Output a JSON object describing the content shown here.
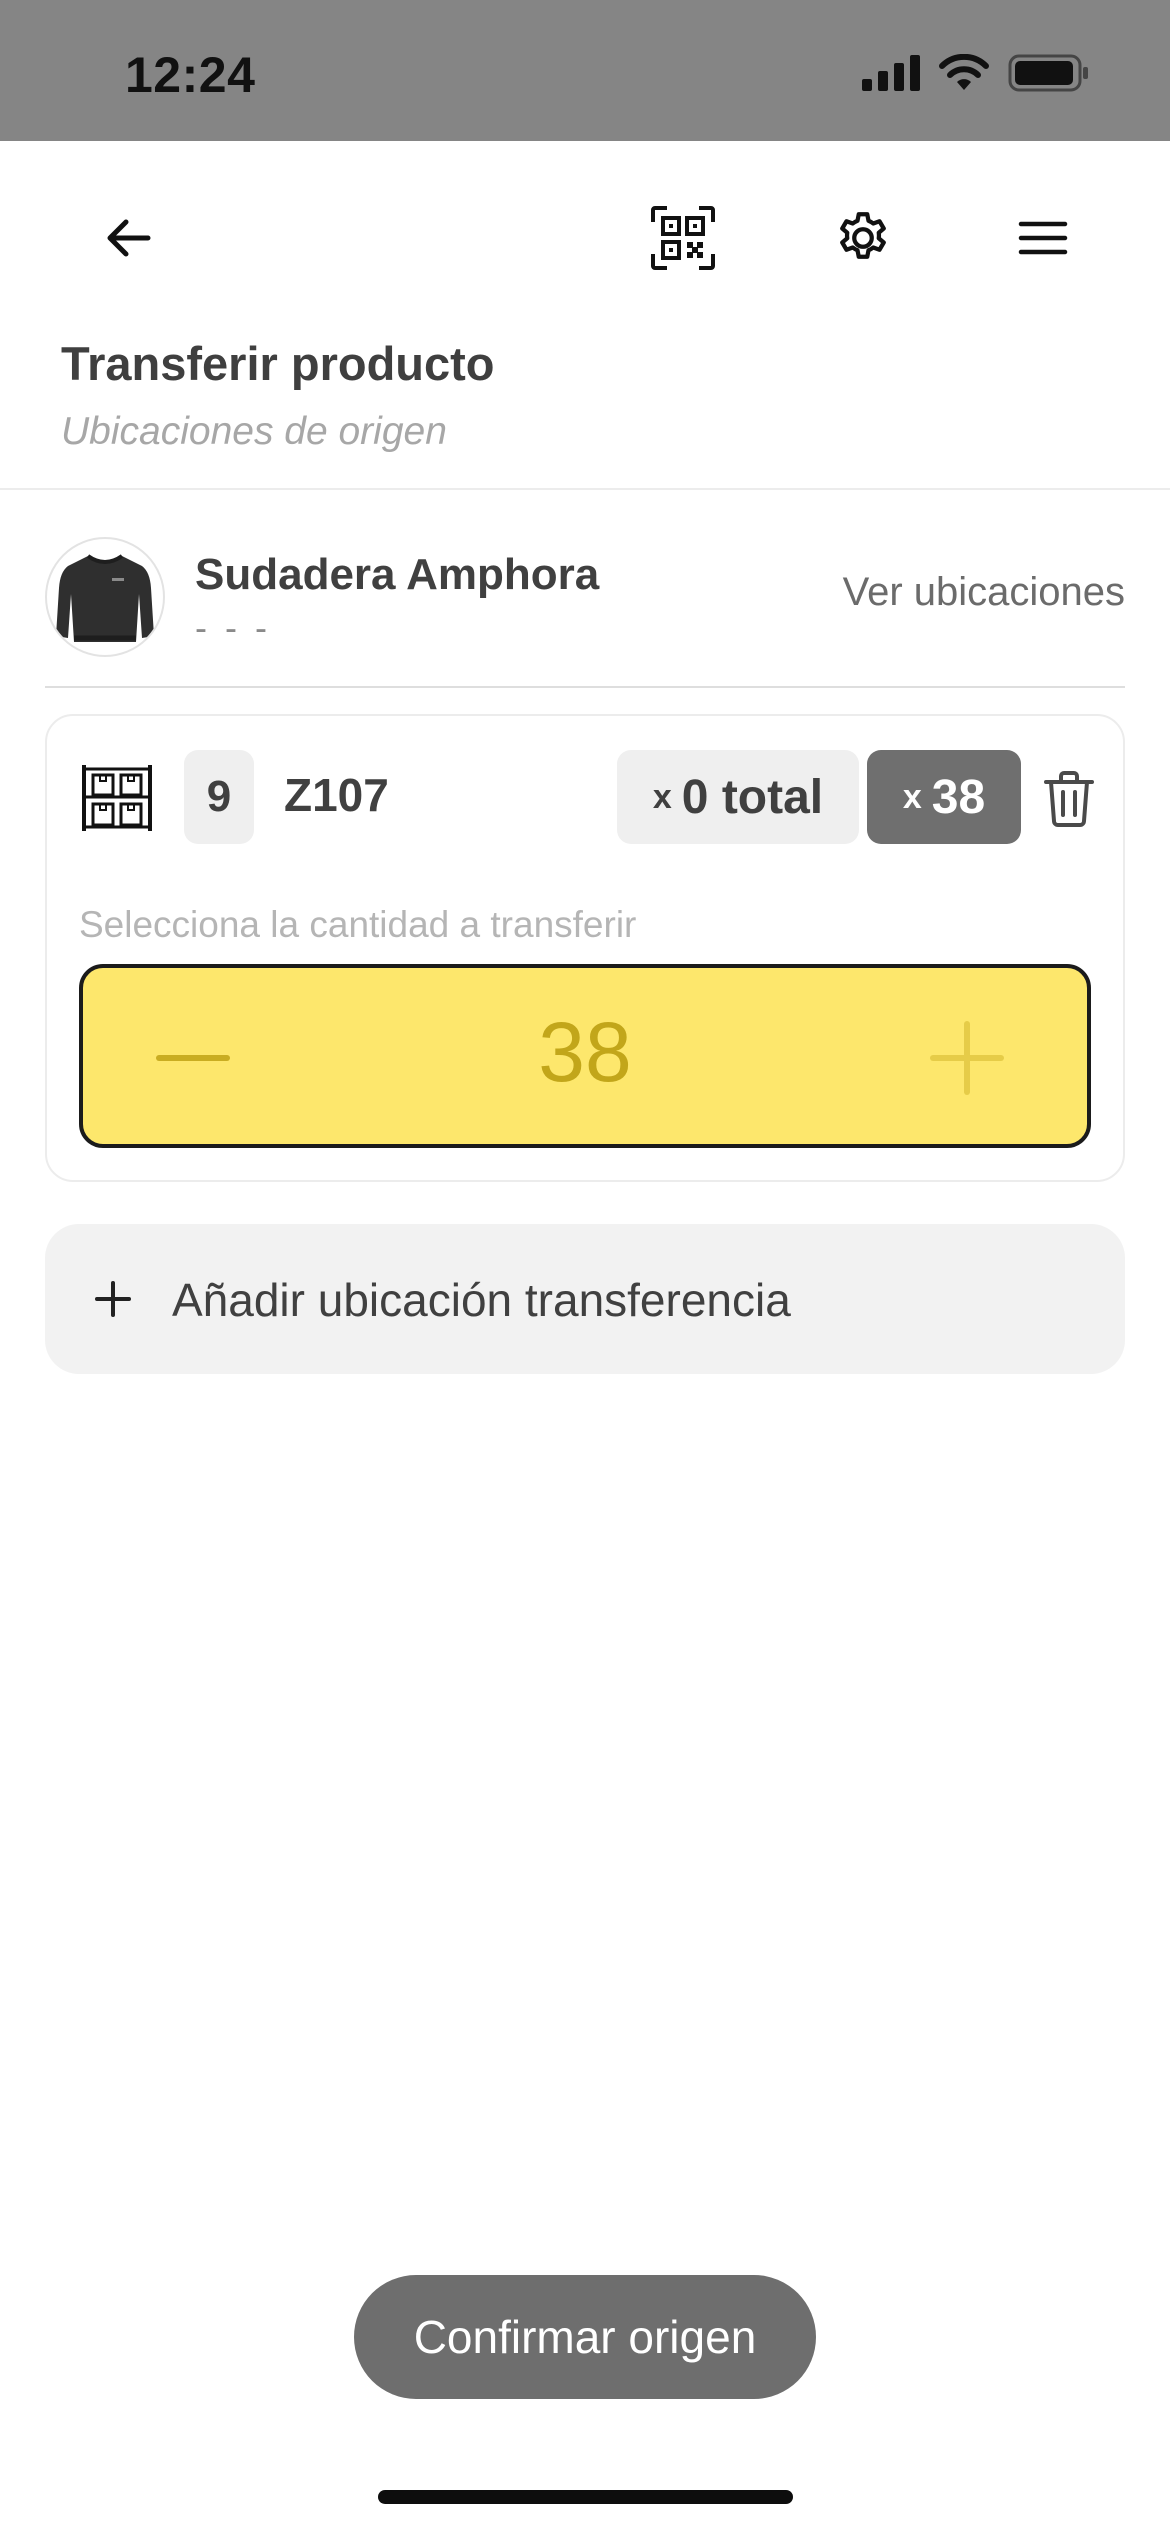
{
  "status_bar": {
    "time": "12:24"
  },
  "nav": {
    "back_icon": "arrow-left-icon",
    "qr_icon": "qr-code-icon",
    "settings_icon": "gear-icon",
    "menu_icon": "hamburger-menu-icon"
  },
  "header": {
    "title": "Transferir producto",
    "subtitle": "Ubicaciones de origen"
  },
  "product": {
    "name": "Sudadera Amphora",
    "sku": "- - -",
    "view_locations_label": "Ver ubicaciones",
    "image_icon": "sweatshirt-icon"
  },
  "location": {
    "icon": "warehouse-shelf-icon",
    "count": "9",
    "code": "Z107",
    "total_prefix": "x",
    "total_label": "0 total",
    "qty_prefix": "x",
    "qty_value": "38",
    "delete_icon": "trash-icon",
    "quantity_label": "Selecciona la cantidad a transferir",
    "stepper_value": "38",
    "stepper_color": "#fde76c"
  },
  "add_location": {
    "label": "Añadir ubicación transferencia",
    "icon": "plus-icon"
  },
  "footer": {
    "confirm_label": "Confirmar origen"
  }
}
